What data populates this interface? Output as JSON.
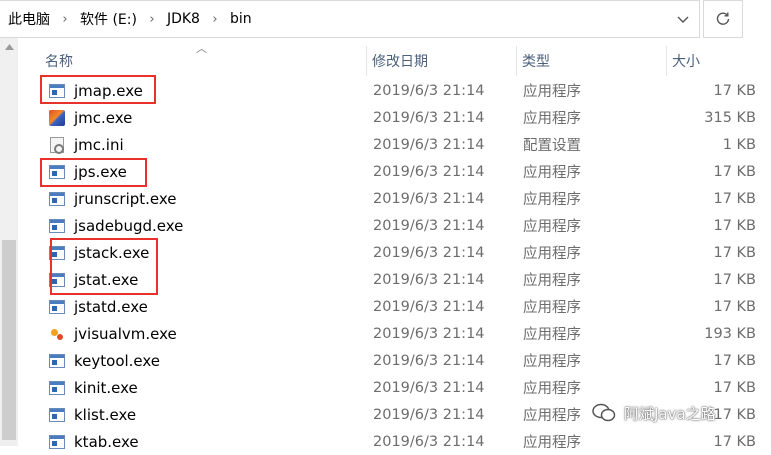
{
  "breadcrumb": [
    "此电脑",
    "软件 (E:)",
    "JDK8",
    "bin"
  ],
  "breadcrumb_separator": "›",
  "columns": {
    "name": "名称",
    "date": "修改日期",
    "type": "类型",
    "size": "大小"
  },
  "files": [
    {
      "name": "jmap.exe",
      "date": "2019/6/3 21:14",
      "type": "应用程序",
      "size": "17 KB",
      "icon": "exe-icon",
      "highlighted": true
    },
    {
      "name": "jmc.exe",
      "date": "2019/6/3 21:14",
      "type": "应用程序",
      "size": "315 KB",
      "icon": "jmc-icon",
      "highlighted": false
    },
    {
      "name": "jmc.ini",
      "date": "2019/6/3 21:14",
      "type": "配置设置",
      "size": "1 KB",
      "icon": "ini-settings-icon",
      "highlighted": false
    },
    {
      "name": "jps.exe",
      "date": "2019/6/3 21:14",
      "type": "应用程序",
      "size": "17 KB",
      "icon": "exe-icon",
      "highlighted": true
    },
    {
      "name": "jrunscript.exe",
      "date": "2019/6/3 21:14",
      "type": "应用程序",
      "size": "17 KB",
      "icon": "exe-icon",
      "highlighted": false
    },
    {
      "name": "jsadebugd.exe",
      "date": "2019/6/3 21:14",
      "type": "应用程序",
      "size": "17 KB",
      "icon": "exe-icon",
      "highlighted": false
    },
    {
      "name": "jstack.exe",
      "date": "2019/6/3 21:14",
      "type": "应用程序",
      "size": "17 KB",
      "icon": "exe-icon",
      "highlighted": true
    },
    {
      "name": "jstat.exe",
      "date": "2019/6/3 21:14",
      "type": "应用程序",
      "size": "17 KB",
      "icon": "exe-icon",
      "highlighted": true
    },
    {
      "name": "jstatd.exe",
      "date": "2019/6/3 21:14",
      "type": "应用程序",
      "size": "17 KB",
      "icon": "exe-icon",
      "highlighted": false
    },
    {
      "name": "jvisualvm.exe",
      "date": "2019/6/3 21:14",
      "type": "应用程序",
      "size": "193 KB",
      "icon": "jvisualvm-icon",
      "highlighted": false
    },
    {
      "name": "keytool.exe",
      "date": "2019/6/3 21:14",
      "type": "应用程序",
      "size": "17 KB",
      "icon": "exe-icon",
      "highlighted": false
    },
    {
      "name": "kinit.exe",
      "date": "2019/6/3 21:14",
      "type": "应用程序",
      "size": "17 KB",
      "icon": "exe-icon",
      "highlighted": false
    },
    {
      "name": "klist.exe",
      "date": "2019/6/3 21:14",
      "type": "应用程序",
      "size": "17 KB",
      "icon": "exe-icon",
      "highlighted": false
    },
    {
      "name": "ktab.exe",
      "date": "2019/6/3 21:14",
      "type": "应用程序",
      "size": "17 KB",
      "icon": "exe-icon",
      "highlighted": false
    }
  ],
  "watermark": "阿斌Java之路",
  "colors": {
    "highlight_box": "#e8312c",
    "header_text": "#4c607a",
    "secondary_text": "#6d6d6d"
  }
}
